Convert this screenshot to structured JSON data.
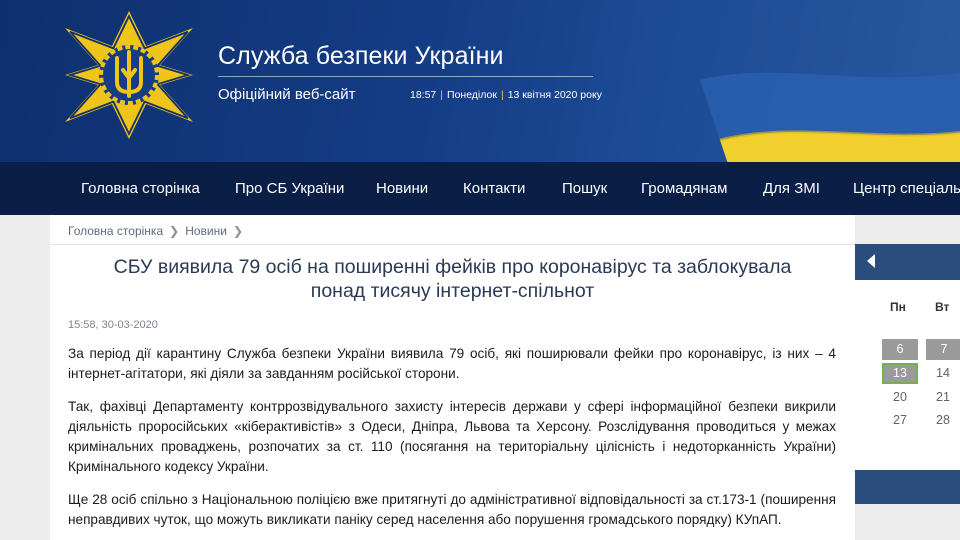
{
  "header": {
    "title": "Служба безпеки України",
    "subtitle": "Офіційний веб-сайт",
    "time": "18:57",
    "weekday": "Понеділок",
    "date": "13 квітня 2020 року",
    "logo_icon": "sbu-emblem-icon",
    "colors": {
      "bg": "#143d86",
      "nav": "#0b1e45",
      "flag_blue": "#2a5fb0",
      "flag_yellow": "#f1cf2c",
      "emblem_gold": "#f0c419"
    }
  },
  "nav": {
    "items": [
      {
        "label": "Головна сторінка"
      },
      {
        "label": "Про СБ України"
      },
      {
        "label": "Новини"
      },
      {
        "label": "Контакти"
      },
      {
        "label": "Пошук"
      },
      {
        "label": "Громадянам"
      },
      {
        "label": "Для ЗМІ"
      },
      {
        "label": "Центр спеціаль"
      }
    ]
  },
  "breadcrumb": {
    "home": "Головна сторінка",
    "section": "Новини",
    "chevron_icon": "chevron-right-icon"
  },
  "article": {
    "title": "СБУ виявила 79 осіб на поширенні фейків про коронавірус та заблокувала понад тисячу інтернет-спільнот",
    "date": "15:58, 30-03-2020",
    "paragraphs": [
      "За період дії карантину Служба безпеки України виявила 79 осіб, які поширювали фейки про коронавірус, із них – 4 інтернет-агітатори, які діяли за завданням російської сторони.",
      "Так, фахівці Департаменту контррозвідувального захисту інтересів держави у сфері інформаційної безпеки викрили діяльність проросійських «кіберактивістів» з Одеси, Дніпра, Львова та Херсону. Розслідування проводиться у межах кримінальних проваджень, розпочатих за ст. 110 (посягання на територіальну цілісність і недоторканність України) Кримінального кодексу України.",
      "Ще 28 осіб спільно з Національною поліцією вже притягнуті до адміністративної відповідальності за ст.173-1 (поширення неправдивих чуток, що можуть викликати паніку серед населення або порушення громадського порядку) КУпАП."
    ]
  },
  "calendar": {
    "prev_icon": "arrow-left-icon",
    "weekdays": [
      "Пн",
      "Вт"
    ],
    "days": [
      {
        "label": "6",
        "state": "has-news"
      },
      {
        "label": "7",
        "state": "has-news"
      },
      {
        "label": "13",
        "state": "today"
      },
      {
        "label": "14",
        "state": "normal"
      },
      {
        "label": "20",
        "state": "normal"
      },
      {
        "label": "21",
        "state": "normal"
      },
      {
        "label": "27",
        "state": "normal"
      },
      {
        "label": "28",
        "state": "normal"
      }
    ]
  }
}
